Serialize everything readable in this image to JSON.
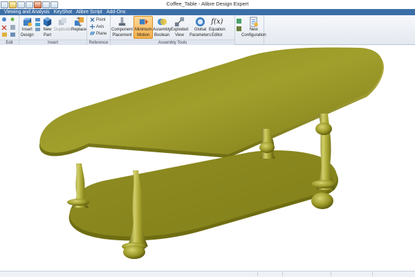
{
  "window": {
    "title": "Coffee_Table - Alibre Design Expert"
  },
  "menu": {
    "items": [
      "Viewing and Analysis",
      "KeyShot",
      "Alibre Script",
      "Add-Ons"
    ]
  },
  "ribbon": {
    "groups": {
      "edit": "Edit",
      "insert": "Insert",
      "reference": "Reference",
      "assembly_tools": "Assembly Tools"
    },
    "buttons": {
      "insert_design": [
        "Insert",
        "Design"
      ],
      "new_part": [
        "New",
        "Part"
      ],
      "duplicate": "Duplicate",
      "replace": "Replace",
      "point": "Point",
      "axis": "Axis",
      "plane": "Plane",
      "component_placement": [
        "Component",
        "Placement"
      ],
      "minimum_motion": [
        "Minimum",
        "Motion"
      ],
      "assembly_boolean": [
        "Assembly",
        "Boolean"
      ],
      "exploded_view": [
        "Exploded",
        "View"
      ],
      "global_parameters": [
        "Global",
        "Parameters"
      ],
      "equation_editor": [
        "Equation",
        "Editor"
      ],
      "equation_symbol": "f(x)",
      "new_configuration": [
        "New",
        "Configuration"
      ]
    },
    "active_button": "minimum_motion"
  },
  "colors": {
    "menubar": "#3c6fa8",
    "model_base": "#9c9a26",
    "model_light": "#c7c45a",
    "model_dark": "#4e4c0c",
    "active_highlight": "#f4b04a"
  },
  "icons": {
    "insert_design": "gear-cube-icon",
    "new_part": "cube-icon",
    "duplicate": "duplicate-icon",
    "replace": "replace-icon",
    "point": "point-icon",
    "axis": "axis-icon",
    "plane": "plane-icon",
    "component_placement": "placement-icon",
    "minimum_motion": "motion-icon",
    "assembly_boolean": "boolean-icon",
    "exploded_view": "explode-icon",
    "global_parameters": "parameters-icon",
    "equation_editor": "equation-icon",
    "new_configuration": "configuration-icon"
  }
}
